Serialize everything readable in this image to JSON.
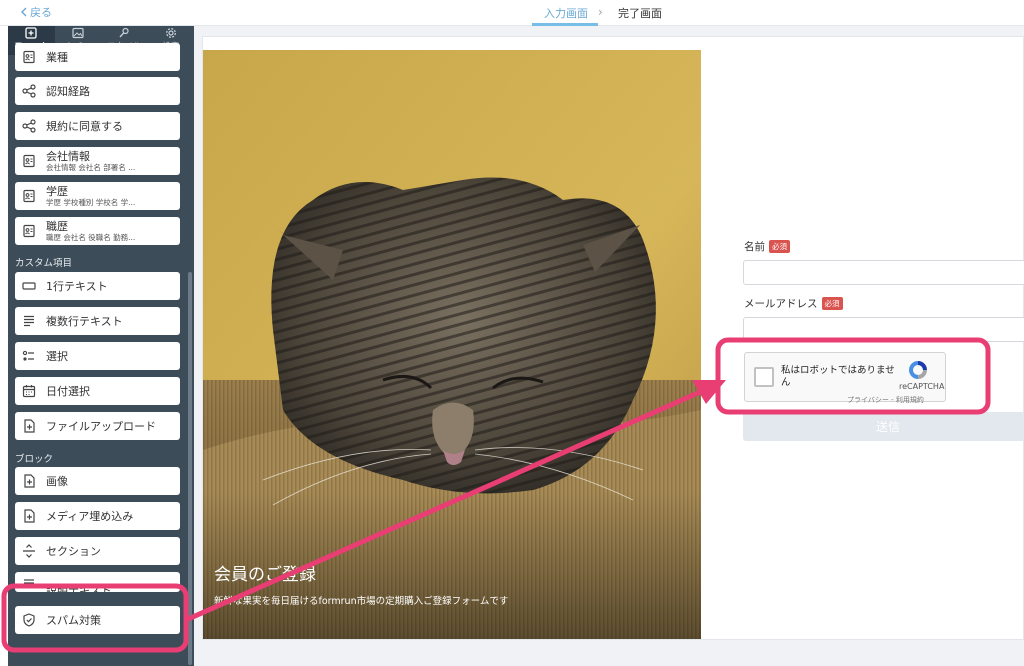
{
  "topbar": {
    "back_label": "戻る",
    "steps": [
      {
        "label": "入力画面"
      },
      {
        "label": "完了画面"
      }
    ]
  },
  "sidebar": {
    "tabs": [
      {
        "label": "フォーム",
        "icon": "plus-square-icon"
      },
      {
        "label": "カバー",
        "icon": "image-icon"
      },
      {
        "label": "スタイル",
        "icon": "paintbrush-icon"
      },
      {
        "label": "設定",
        "icon": "gear-icon"
      }
    ],
    "partial_item_label": "業種",
    "items": [
      {
        "label": "認知経路",
        "icon": "share-icon"
      },
      {
        "label": "規約に同意する",
        "icon": "share-icon"
      },
      {
        "label": "会社情報",
        "sub": "会社情報 会社名 部署名 ...",
        "icon": "id-card-icon"
      },
      {
        "label": "学歴",
        "sub": "学歴 学校種別 学校名 学...",
        "icon": "id-card-icon"
      },
      {
        "label": "職歴",
        "sub": "職歴 会社名 役職名 勤務...",
        "icon": "id-card-icon"
      }
    ],
    "custom_heading": "カスタム項目",
    "custom_items": [
      {
        "label": "1行テキスト",
        "icon": "single-line-text-icon"
      },
      {
        "label": "複数行テキスト",
        "icon": "multi-line-text-icon"
      },
      {
        "label": "選択",
        "icon": "select-list-icon"
      },
      {
        "label": "日付選択",
        "icon": "calendar-icon"
      },
      {
        "label": "ファイルアップロード",
        "icon": "file-upload-icon"
      }
    ],
    "block_heading": "ブロック",
    "block_items": [
      {
        "label": "画像",
        "icon": "image-file-icon"
      },
      {
        "label": "メディア埋め込み",
        "icon": "media-embed-icon"
      },
      {
        "label": "セクション",
        "icon": "section-divider-icon"
      },
      {
        "label": "説明テキスト",
        "icon": "text-icon"
      },
      {
        "label": "スパム対策",
        "icon": "shield-check-icon"
      }
    ]
  },
  "cover": {
    "title": "会員のご登録",
    "subtitle": "新鮮な果実を毎日届けるformrun市場の定期購入ご登録フォームです"
  },
  "form": {
    "name_label": "名前",
    "email_label": "メールアドレス",
    "required_badge": "必須",
    "recaptcha_text": "私はロボットではありません",
    "recaptcha_brand": "reCAPTCHA",
    "recaptcha_links": "プライバシー - 利用規約",
    "submit_label": "送信"
  },
  "colors": {
    "accent": "#78bde6",
    "sidebar": "#3d4c59",
    "highlight": "#e83e73"
  }
}
